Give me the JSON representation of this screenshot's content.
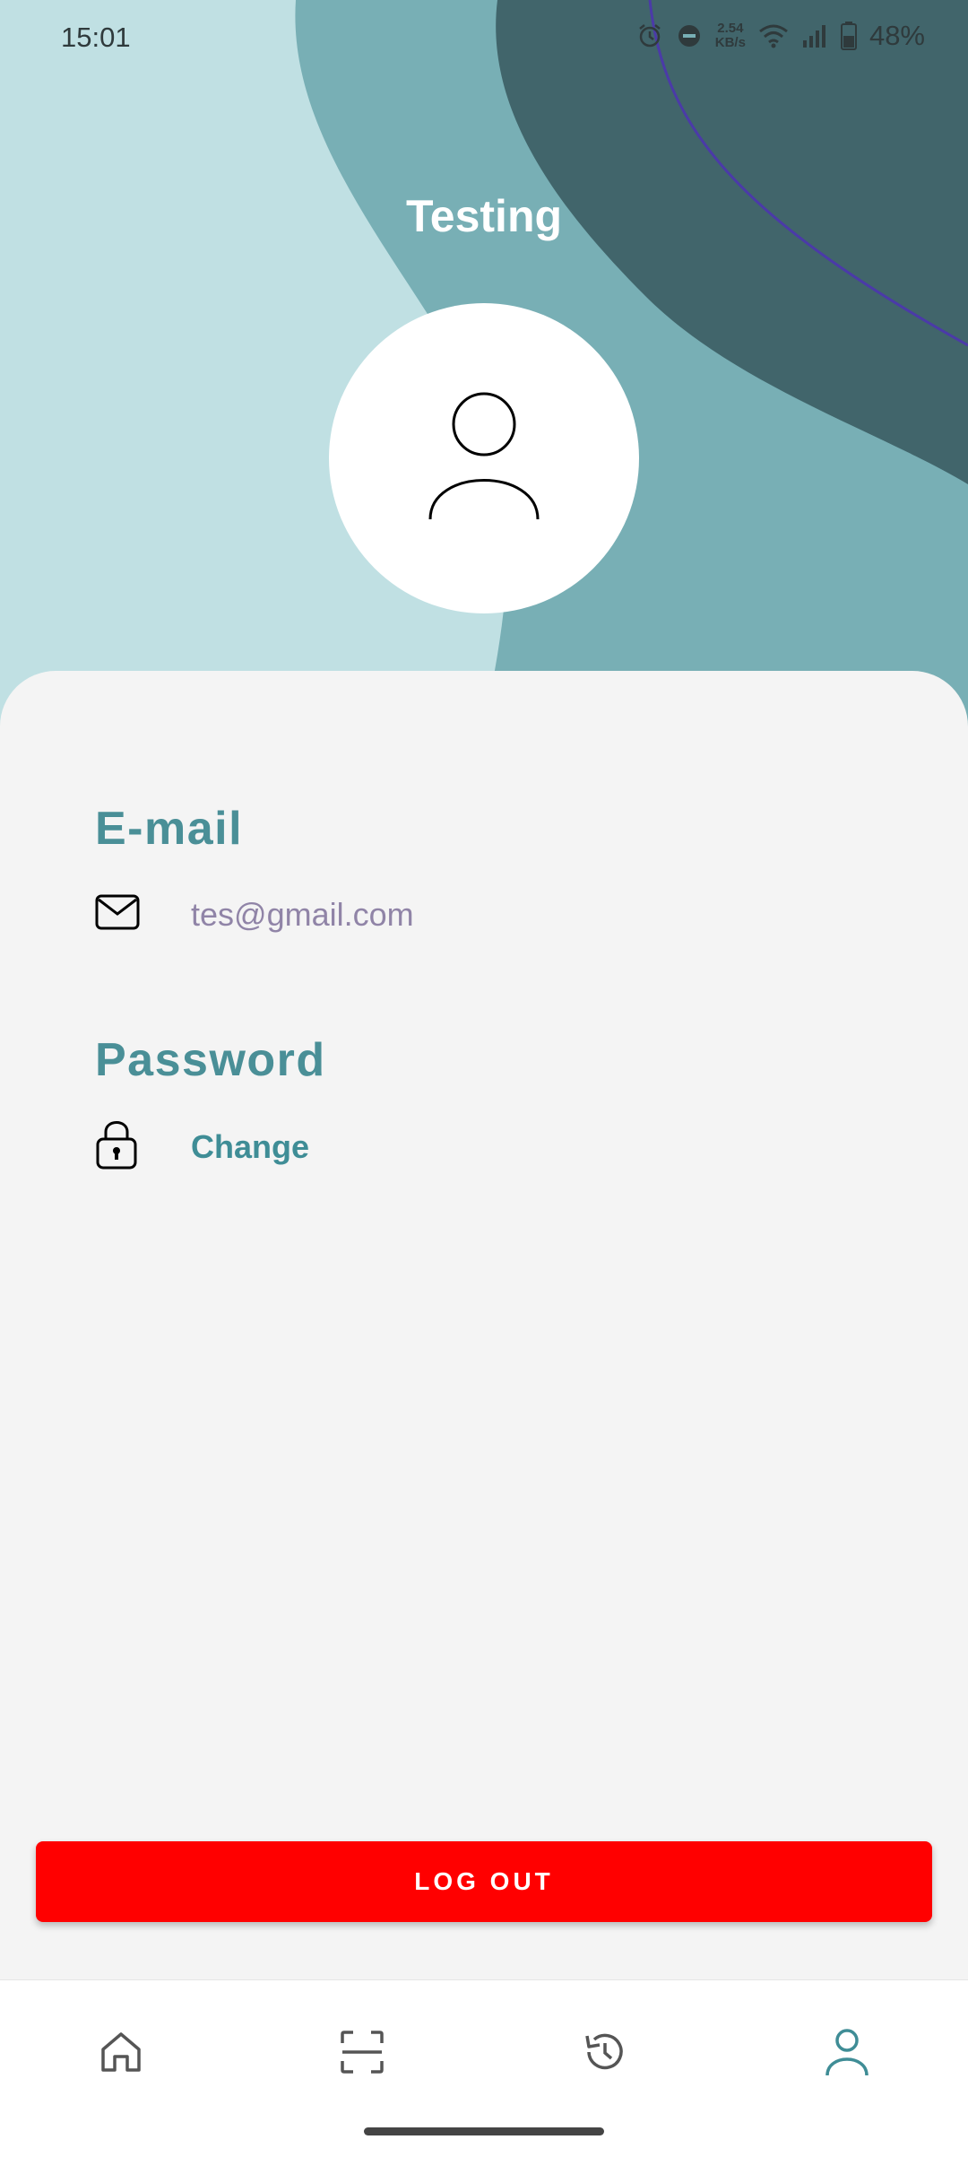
{
  "status_bar": {
    "time": "15:01",
    "net_speed_value": "2.54",
    "net_speed_unit": "KB/s",
    "battery": "48%"
  },
  "profile": {
    "title": "Testing"
  },
  "email_section": {
    "label": "E-mail",
    "value": "tes@gmail.com",
    "icon": "mail-icon"
  },
  "password_section": {
    "label": "Password",
    "action": "Change",
    "icon": "lock-icon"
  },
  "logout_button": {
    "label": "LOG OUT",
    "color": "#ff0000"
  },
  "bottom_nav": {
    "items": [
      {
        "icon": "home-icon",
        "active": false
      },
      {
        "icon": "scan-icon",
        "active": false
      },
      {
        "icon": "history-icon",
        "active": false
      },
      {
        "icon": "profile-icon",
        "active": true
      }
    ],
    "active_color": "#3f8d96",
    "inactive_color": "#555555"
  },
  "colors": {
    "accent": "#4a8f97",
    "header_light": "#c0e0e3",
    "header_mid": "#78afb5",
    "header_dark": "#41656b"
  }
}
